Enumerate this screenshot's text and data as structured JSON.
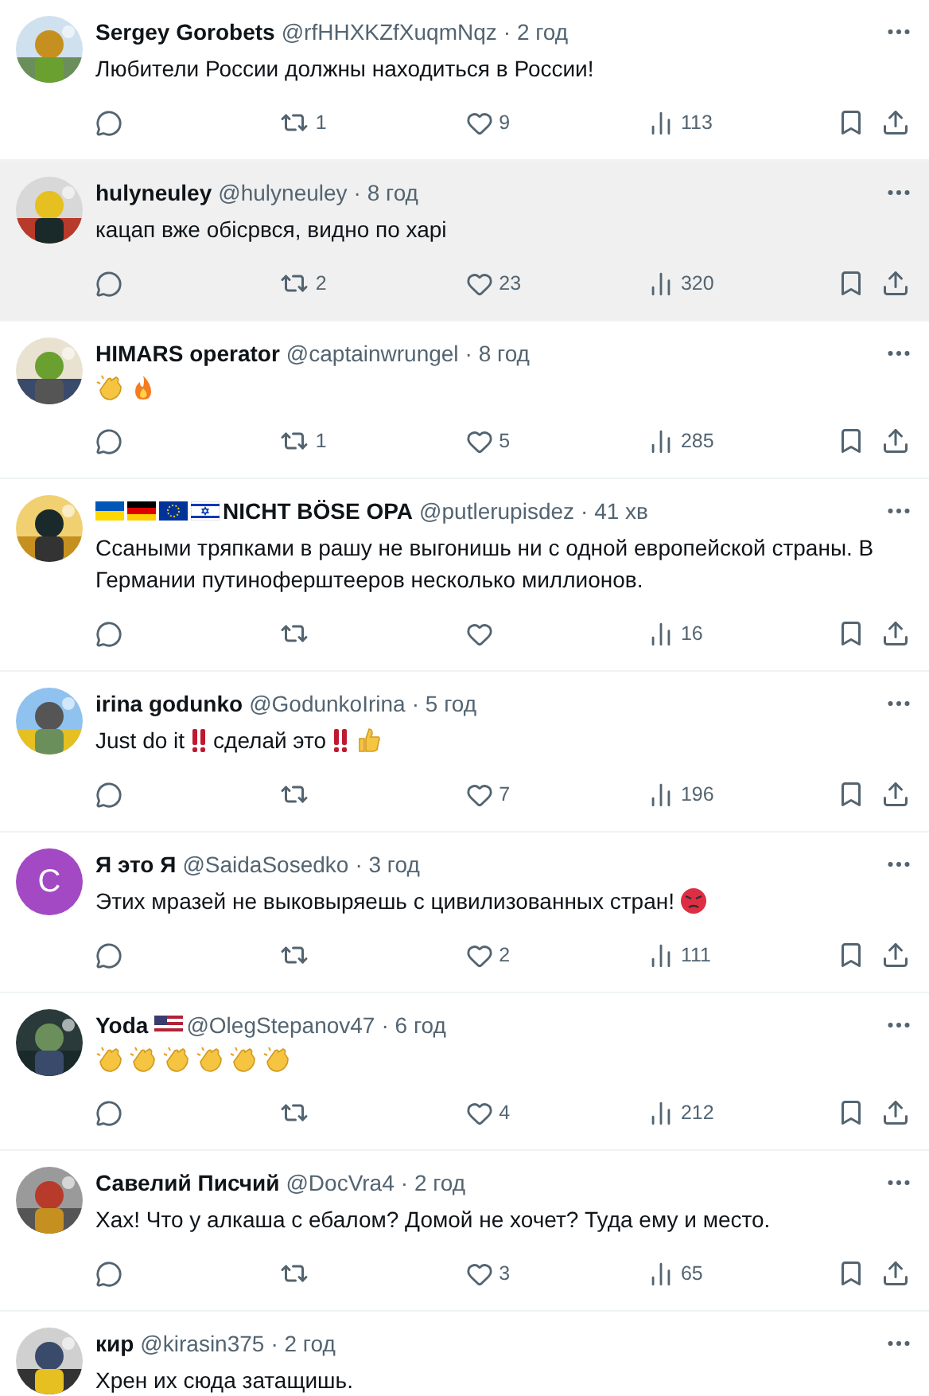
{
  "tweets": [
    {
      "name": "Sergey Gorobets",
      "handle": "@rfHHXKZfXuqmNqz",
      "time": "· 2 год",
      "avatar": {
        "kind": "picture"
      },
      "highlighted": false,
      "body": [
        {
          "kind": "text",
          "text": "Любители России должны находиться в России!"
        }
      ],
      "actions": {
        "retweets": "1",
        "likes": "9",
        "views": "113"
      }
    },
    {
      "name": "hulyneuley",
      "handle": "@hulyneuley",
      "time": "· 8 год",
      "avatar": {
        "kind": "picture"
      },
      "highlighted": true,
      "body": [
        {
          "kind": "text",
          "text": "кацап вже обісрвся, видно по харі"
        }
      ],
      "actions": {
        "retweets": "2",
        "likes": "23",
        "views": "320"
      }
    },
    {
      "name": "HIMARS operator",
      "handle": "@captainwrungel",
      "time": "· 8 год",
      "avatar": {
        "kind": "picture"
      },
      "highlighted": false,
      "body": [
        {
          "kind": "clap"
        },
        {
          "kind": "fire"
        }
      ],
      "actions": {
        "retweets": "1",
        "likes": "5",
        "views": "285"
      }
    },
    {
      "name": "NICHT BÖSE OPA",
      "name_flags_before": [
        {
          "kind": "ua"
        },
        {
          "kind": "de"
        },
        {
          "kind": "eu"
        },
        {
          "kind": "il"
        }
      ],
      "handle": "@putlerupisdez",
      "time": "· 41 хв",
      "avatar": {
        "kind": "picture"
      },
      "highlighted": false,
      "body": [
        {
          "kind": "text",
          "text": "Ссаными тряпками в рашу не выгонишь ни с одной европейской страны. В Германии путиноферштееров несколько миллионов."
        }
      ],
      "actions": {
        "views": "16"
      }
    },
    {
      "name": "irina godunko",
      "handle": "@GodunkoIrina",
      "time": "· 5 год",
      "avatar": {
        "kind": "picture"
      },
      "highlighted": false,
      "body": [
        {
          "kind": "text",
          "text": "Just do it"
        },
        {
          "kind": "bangbang"
        },
        {
          "kind": "text",
          "text": "сделай это"
        },
        {
          "kind": "bangbang"
        },
        {
          "kind": "thumbs"
        }
      ],
      "actions": {
        "likes": "7",
        "views": "196"
      }
    },
    {
      "name": "Я это Я",
      "handle": "@SaidaSosedko",
      "time": "· 3 год",
      "avatar": {
        "kind": "letter",
        "letter": "C",
        "color": "#a349c4"
      },
      "highlighted": false,
      "body": [
        {
          "kind": "text",
          "text": "Этих мразей не выковыряешь с цивилизованных стран!"
        },
        {
          "kind": "angry"
        }
      ],
      "actions": {
        "likes": "2",
        "views": "111"
      }
    },
    {
      "name": "Yoda",
      "name_flags_after": [
        {
          "kind": "us"
        }
      ],
      "handle": "@OlegStepanov47",
      "time": "· 6 год",
      "avatar": {
        "kind": "picture"
      },
      "highlighted": false,
      "body": [
        {
          "kind": "clap"
        },
        {
          "kind": "clap"
        },
        {
          "kind": "clap"
        },
        {
          "kind": "clap"
        },
        {
          "kind": "clap"
        },
        {
          "kind": "clap"
        }
      ],
      "actions": {
        "likes": "4",
        "views": "212"
      }
    },
    {
      "name": "Савелий Писчий",
      "handle": "@DocVra4",
      "time": "· 2 год",
      "avatar": {
        "kind": "picture"
      },
      "highlighted": false,
      "body": [
        {
          "kind": "text",
          "text": "Хах! Что у алкаша с ебалом? Домой не хочет? Туда ему и место."
        }
      ],
      "actions": {
        "likes": "3",
        "views": "65"
      }
    },
    {
      "name": "кир",
      "handle": "@kirasin375",
      "time": "· 2 год",
      "avatar": {
        "kind": "picture"
      },
      "highlighted": false,
      "body": [
        {
          "kind": "text",
          "text": "Хрен их сюда затащишь."
        }
      ]
    }
  ]
}
